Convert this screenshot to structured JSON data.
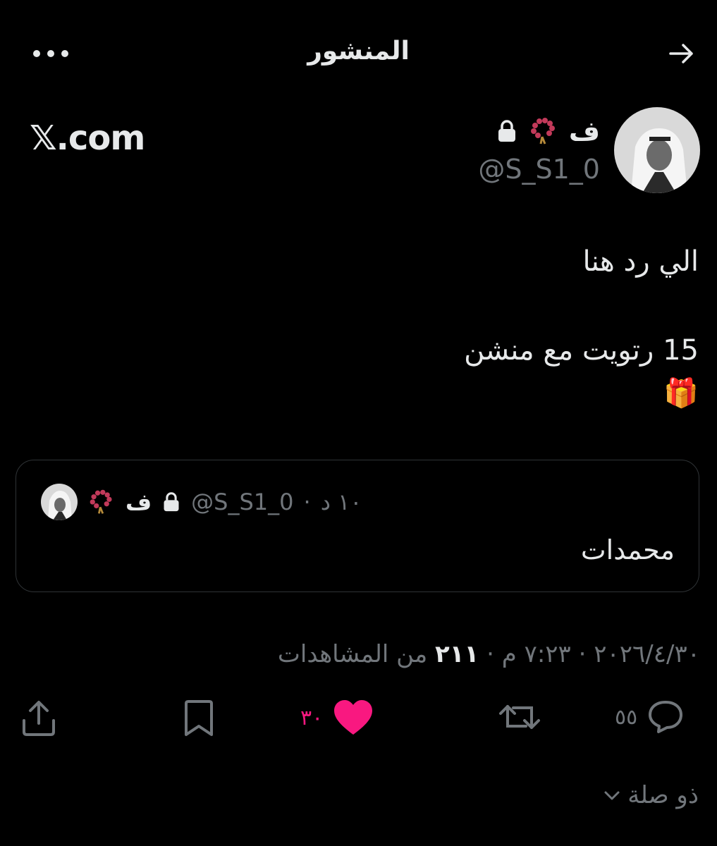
{
  "header": {
    "title": "المنشور",
    "back_icon": "arrow-right-icon",
    "more_icon": "more-dots-icon"
  },
  "watermark": "𝕏.com",
  "author": {
    "name": "ف",
    "handle": "@S_S1_0",
    "lock_icon": "lock-icon",
    "emoji_icon": "prayer-beads-icon"
  },
  "post": {
    "line1": "الي رد هنا",
    "line2": "15 رتويت مع منشن",
    "line3": "🎁"
  },
  "quote": {
    "name": "ف",
    "handle": "@S_S1_0",
    "time": "١٠ د",
    "separator": "·",
    "text": "محمدات"
  },
  "meta": {
    "date": "٢٠٢٦/٤/٣٠",
    "sep": "·",
    "time": "٧:٢٣ م",
    "views_count": "٢١١",
    "views_label": "من المشاهدات"
  },
  "actions": {
    "replies": "٥٥",
    "retweets": "",
    "likes": "٣٠",
    "like_color": "#f91880"
  },
  "related": {
    "label": "ذو صلة"
  }
}
